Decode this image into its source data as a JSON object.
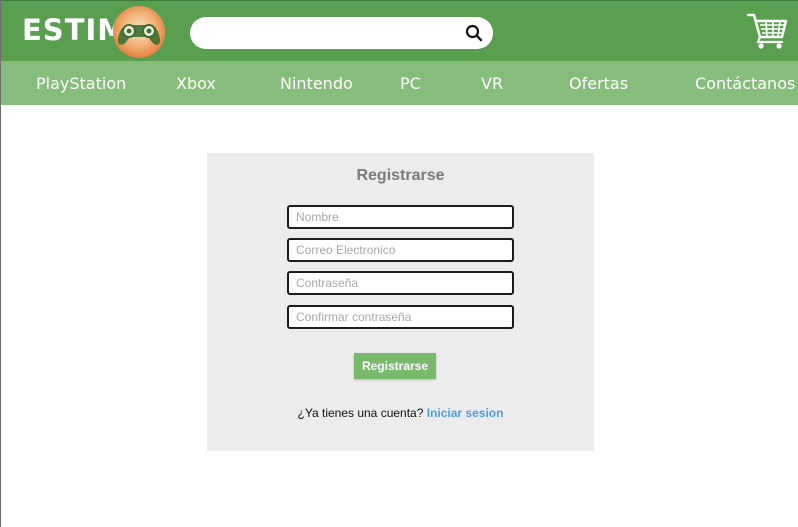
{
  "header": {
    "logo_text": "ESTIM",
    "search": {
      "value": "",
      "placeholder": ""
    },
    "icons": {
      "search": "search-icon",
      "cart": "shopping-cart-icon",
      "logo": "gamepad-logo"
    }
  },
  "nav": {
    "items": [
      "PlayStation",
      "Xbox",
      "Nintendo",
      "PC",
      "VR",
      "Ofertas",
      "Contáctanos"
    ]
  },
  "register_form": {
    "title": "Registrarse",
    "fields": {
      "name": {
        "placeholder": "Nombre",
        "value": ""
      },
      "email": {
        "placeholder": "Correo Electronico",
        "value": ""
      },
      "password": {
        "placeholder": "Contraseña",
        "value": ""
      },
      "confirm_password": {
        "placeholder": "Confirmar contraseña",
        "value": ""
      }
    },
    "submit_label": "Registrarse",
    "login_prompt": "¿Ya tienes una cuenta?",
    "login_link": "Iniciar sesion"
  },
  "colors": {
    "header_bg": "#5a9f50",
    "nav_bg": "#86bd7b",
    "button_bg": "#78b96b",
    "link": "#4a9fe0",
    "panel_bg": "#ececec"
  }
}
